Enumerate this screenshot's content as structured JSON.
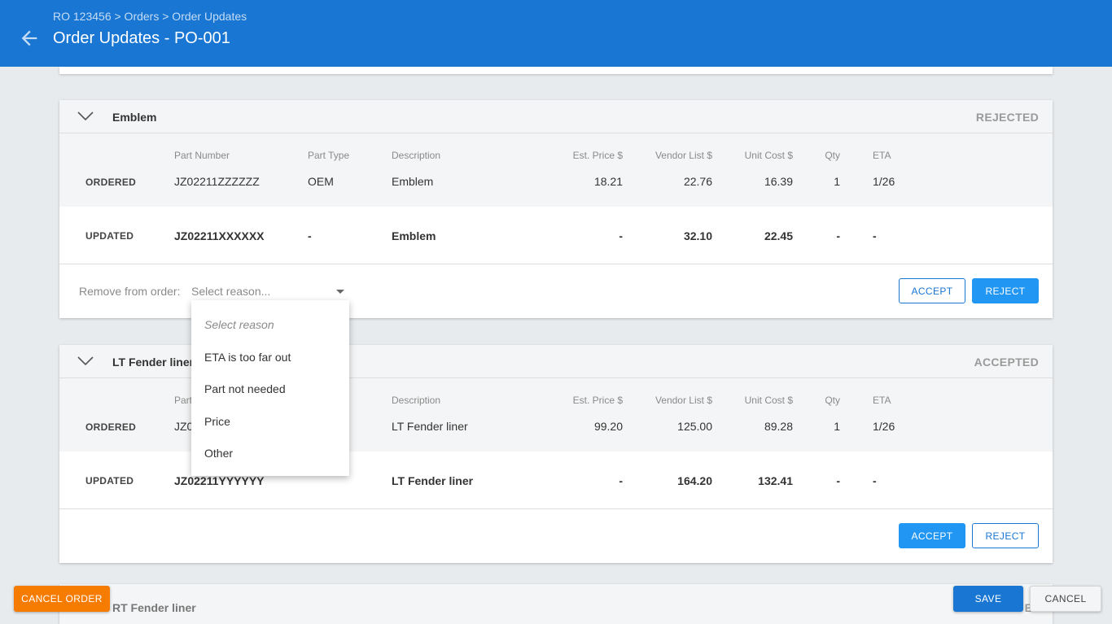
{
  "header": {
    "breadcrumb": "RO 123456 > Orders > Order Updates",
    "title": "Order Updates - PO-001",
    "back_icon": "arrow-left-icon"
  },
  "columns": {
    "part_number": "Part Number",
    "part_type": "Part Type",
    "description": "Description",
    "est_price": "Est. Price $",
    "vendor_list": "Vendor List $",
    "unit_cost": "Unit Cost $",
    "qty": "Qty",
    "eta": "ETA"
  },
  "row_labels": {
    "ordered": "ORDERED",
    "updated": "UPDATED"
  },
  "cards": [
    {
      "title": "Emblem",
      "status": "REJECTED",
      "ordered": {
        "part_number": "JZ02211ZZZZZZ",
        "part_type": "OEM",
        "description": "Emblem",
        "est_price": "18.21",
        "vendor_list": "22.76",
        "unit_cost": "16.39",
        "qty": "1",
        "eta": "1/26"
      },
      "updated": {
        "part_number": "JZ02211XXXXXX",
        "part_type": "-",
        "description": "Emblem",
        "est_price": "-",
        "vendor_list": "32.10",
        "unit_cost": "22.45",
        "qty": "-",
        "eta": "-"
      },
      "remove_label": "Remove from order:",
      "reason_placeholder": "Select reason...",
      "accept_label": "ACCEPT",
      "reject_label": "REJECT"
    },
    {
      "title": "LT Fender liner",
      "status": "ACCEPTED",
      "ordered": {
        "part_number": "JZ0",
        "part_type": "",
        "description": "LT Fender liner",
        "est_price": "99.20",
        "vendor_list": "125.00",
        "unit_cost": "89.28",
        "qty": "1",
        "eta": "1/26"
      },
      "updated": {
        "part_number": "JZ02211YYYYYY",
        "part_type": "",
        "description": "LT Fender liner",
        "est_price": "-",
        "vendor_list": "164.20",
        "unit_cost": "132.41",
        "qty": "-",
        "eta": "-"
      },
      "part_number_header_partial": "Part",
      "accept_label": "ACCEPT",
      "reject_label": "REJECT"
    }
  ],
  "dropdown": {
    "placeholder": "Select reason",
    "options": [
      "ETA is too far out",
      "Part not needed",
      "Price",
      "Other"
    ]
  },
  "peek_card": {
    "title": "RT Fender liner",
    "status": "E"
  },
  "footer": {
    "cancel_order_label": "CANCEL ORDER",
    "save_label": "SAVE",
    "cancel_label": "CANCEL"
  },
  "colors": {
    "header_bg": "#1976d2",
    "primary": "#2196f3",
    "cancel_order": "#f57c00"
  }
}
